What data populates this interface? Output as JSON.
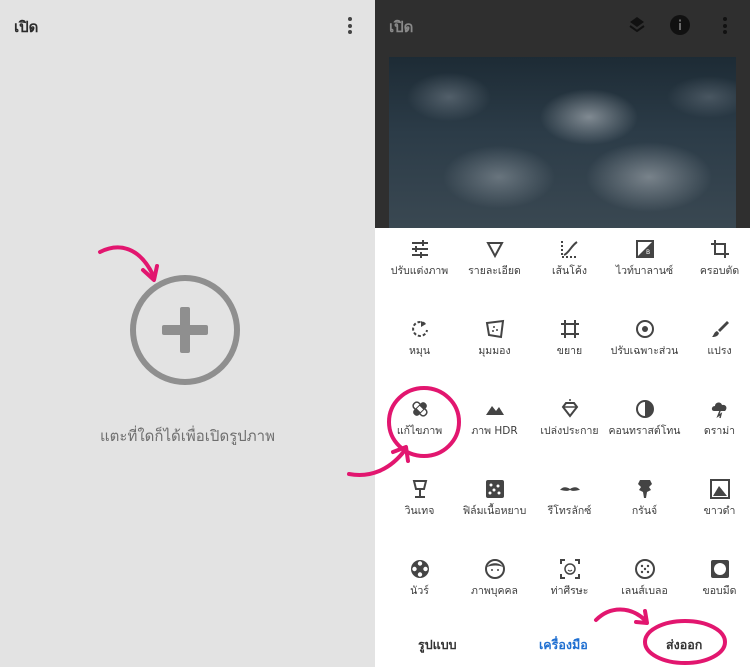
{
  "left": {
    "title": "เปิด",
    "hint": "แตะที่ใดก็ได้เพื่อเปิดรูปภาพ",
    "add_icon": "plus-circle-icon",
    "menu_icon": "more-vert-icon"
  },
  "right": {
    "title": "เปิด",
    "header_icons": [
      "layers-icon",
      "info-icon",
      "more-vert-icon"
    ],
    "tools": [
      {
        "label": "ปรับแต่งภาพ",
        "icon": "tune-icon"
      },
      {
        "label": "รายละเอียด",
        "icon": "details-icon"
      },
      {
        "label": "เส้นโค้ง",
        "icon": "curves-icon"
      },
      {
        "label": "ไวท์บาลานซ์",
        "icon": "white-balance-icon"
      },
      {
        "label": "ครอบตัด",
        "icon": "crop-icon"
      },
      {
        "label": "หมุน",
        "icon": "rotate-icon"
      },
      {
        "label": "มุมมอง",
        "icon": "perspective-icon"
      },
      {
        "label": "ขยาย",
        "icon": "expand-icon"
      },
      {
        "label": "ปรับเฉพาะส่วน",
        "icon": "selective-icon"
      },
      {
        "label": "แปรง",
        "icon": "brush-icon"
      },
      {
        "label": "แก้ไขภาพ",
        "icon": "healing-icon"
      },
      {
        "label": "ภาพ HDR",
        "icon": "hdr-icon"
      },
      {
        "label": "เปล่งประกาย",
        "icon": "glamour-icon"
      },
      {
        "label": "คอนทราสต์โทน",
        "icon": "tonal-contrast-icon"
      },
      {
        "label": "ดราม่า",
        "icon": "drama-icon"
      },
      {
        "label": "วินเทจ",
        "icon": "vintage-icon"
      },
      {
        "label": "ฟิล์มเนื้อหยาบ",
        "icon": "grainy-film-icon"
      },
      {
        "label": "รีโทรลักซ์",
        "icon": "retrolux-icon"
      },
      {
        "label": "กรันจ์",
        "icon": "grunge-icon"
      },
      {
        "label": "ขาวดำ",
        "icon": "black-white-icon"
      },
      {
        "label": "นัวร์",
        "icon": "noir-icon"
      },
      {
        "label": "ภาพบุคคล",
        "icon": "portrait-icon"
      },
      {
        "label": "ท่าศีรษะ",
        "icon": "head-pose-icon"
      },
      {
        "label": "เลนส์เบลอ",
        "icon": "lens-blur-icon"
      },
      {
        "label": "ขอบมืด",
        "icon": "vignette-icon"
      }
    ],
    "bottom_tabs": [
      {
        "label": "รูปแบบ",
        "color": "#333333"
      },
      {
        "label": "เครื่องมือ",
        "color": "#1f6fd1"
      },
      {
        "label": "ส่งออก",
        "color": "#333333"
      }
    ]
  },
  "colors": {
    "accent": "#1f6fd1",
    "highlight": "#e2166f",
    "left_bg": "#e3e3e3",
    "header_dark": "#2f2f2f"
  }
}
